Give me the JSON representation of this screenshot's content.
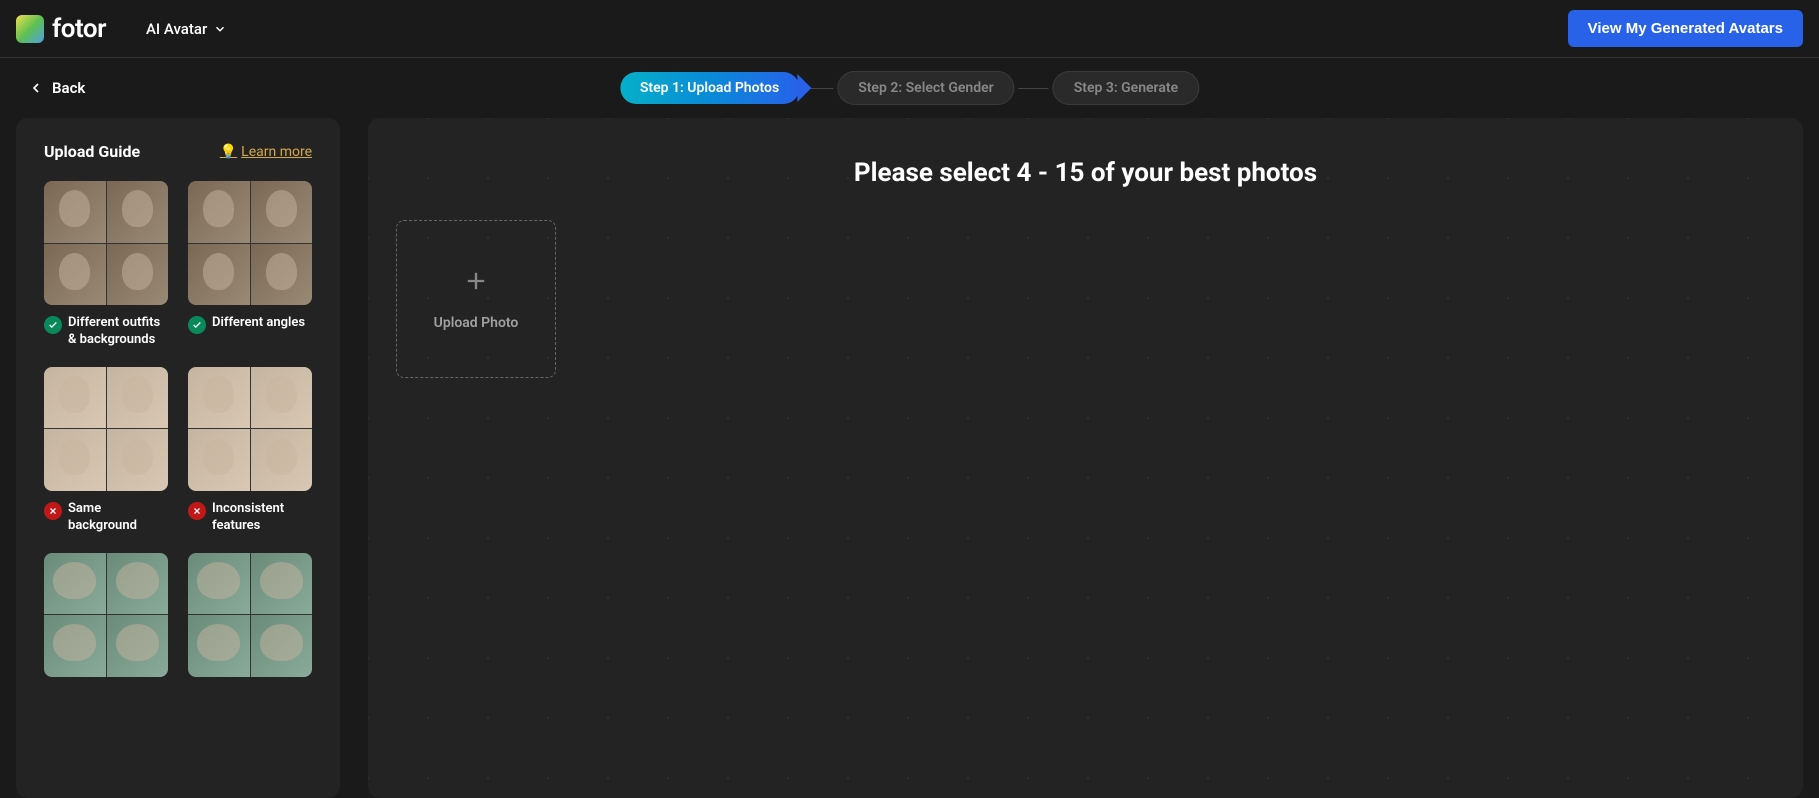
{
  "header": {
    "logo_text": "fotor",
    "nav_item": "AI Avatar",
    "view_avatars_btn": "View My Generated Avatars"
  },
  "subheader": {
    "back_label": "Back",
    "steps": [
      {
        "label": "Step 1: Upload Photos",
        "active": true
      },
      {
        "label": "Step 2: Select Gender",
        "active": false
      },
      {
        "label": "Step 3: Generate",
        "active": false
      }
    ]
  },
  "sidebar": {
    "title": "Upload Guide",
    "learn_more": "Learn more",
    "guides": [
      {
        "label": "Different outfits & backgrounds",
        "status": "good"
      },
      {
        "label": "Different angles",
        "status": "good"
      },
      {
        "label": "Same background",
        "status": "bad"
      },
      {
        "label": "Inconsistent features",
        "status": "bad"
      }
    ]
  },
  "content": {
    "title": "Please select 4 - 15 of your best photos",
    "upload_label": "Upload Photo"
  }
}
